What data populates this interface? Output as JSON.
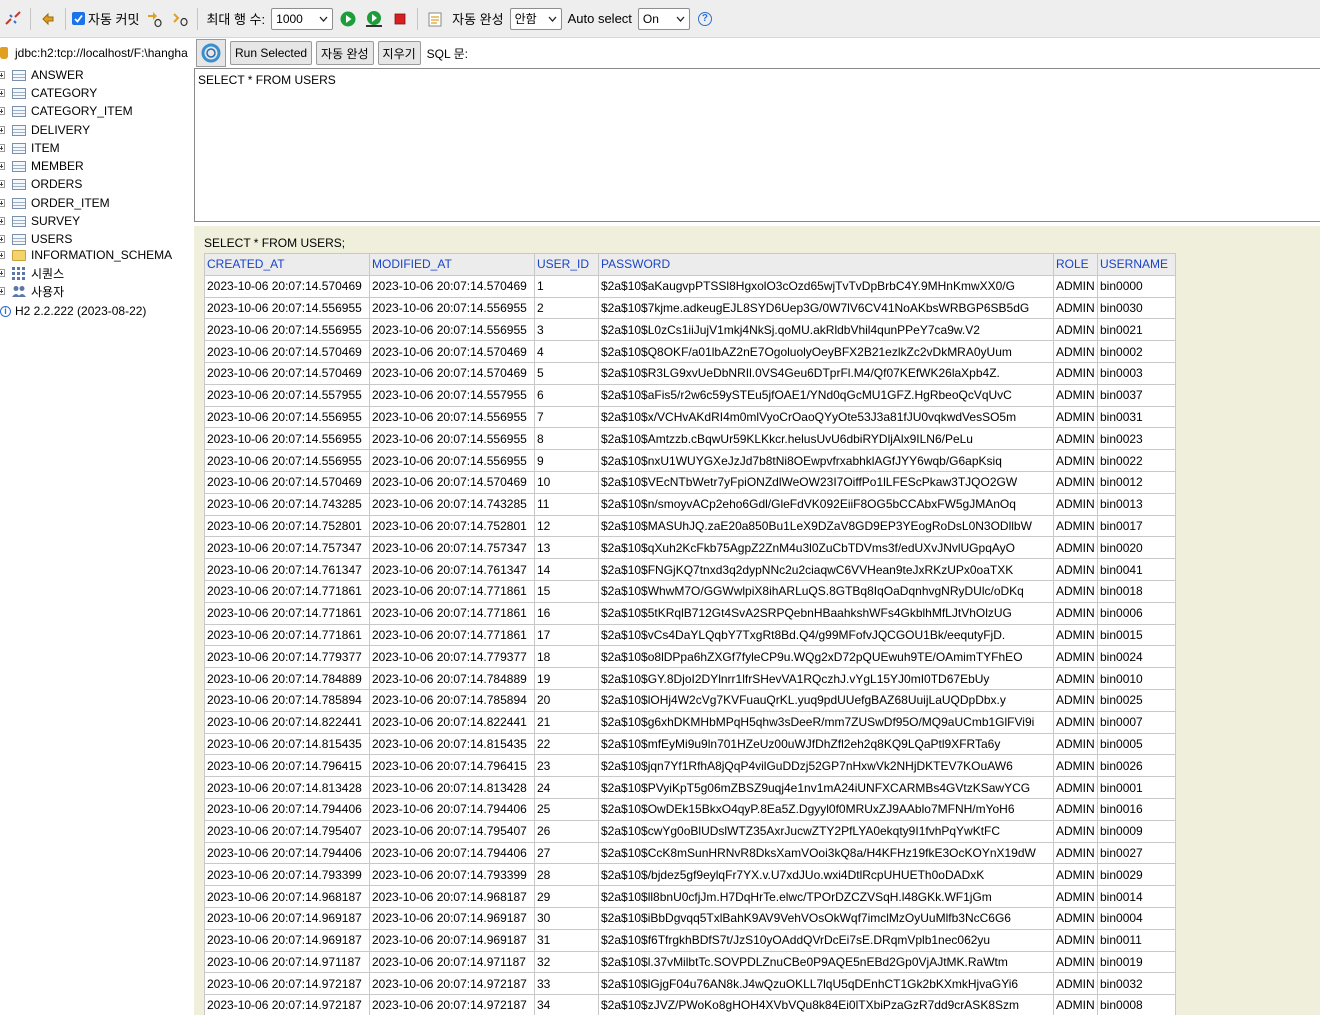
{
  "toolbar": {
    "auto_commit_label": "자동 커밋",
    "max_rows_label": "최대 행 수:",
    "max_rows_value": "1000",
    "autocomplete_label": "자동 완성",
    "autocomplete_value": "안함",
    "auto_select_label": "Auto select",
    "auto_select_value": "On",
    "help_glyph": "?"
  },
  "tree": {
    "connection": "jdbc:h2:tcp://localhost/F:\\hangha",
    "tables": [
      "ANSWER",
      "CATEGORY",
      "CATEGORY_ITEM",
      "DELIVERY",
      "ITEM",
      "MEMBER",
      "ORDERS",
      "ORDER_ITEM",
      "SURVEY",
      "USERS"
    ],
    "info_schema": "INFORMATION_SCHEMA",
    "sequences": "시퀀스",
    "users": "사용자",
    "version": "H2 2.2.222 (2023-08-22)"
  },
  "sqlbar": {
    "run_selected": "Run Selected",
    "auto_complete": "자동 완성",
    "clear": "지우기",
    "sql_label": "SQL 문:"
  },
  "editor": {
    "text": "SELECT * FROM USERS"
  },
  "result": {
    "query": "SELECT * FROM USERS;",
    "columns": [
      "CREATED_AT",
      "MODIFIED_AT",
      "USER_ID",
      "PASSWORD",
      "ROLE",
      "USERNAME"
    ],
    "rows": [
      [
        "2023-10-06 20:07:14.570469",
        "2023-10-06 20:07:14.570469",
        "1",
        "$2a$10$aKaugvpPTSSl8HgxolO3cOzd65wjTvTvDpBrbC4Y.9MHnKmwXX0/G",
        "ADMIN",
        "bin0000"
      ],
      [
        "2023-10-06 20:07:14.556955",
        "2023-10-06 20:07:14.556955",
        "2",
        "$2a$10$7kjme.adkeugEJL8SYD6Uep3G/0W7lV6CV41NoAKbsWRBGP6SB5dG",
        "ADMIN",
        "bin0030"
      ],
      [
        "2023-10-06 20:07:14.556955",
        "2023-10-06 20:07:14.556955",
        "3",
        "$2a$10$L0zCs1iiJujV1mkj4NkSj.qoMU.akRldbVhil4qunPPeY7ca9w.V2",
        "ADMIN",
        "bin0021"
      ],
      [
        "2023-10-06 20:07:14.570469",
        "2023-10-06 20:07:14.570469",
        "4",
        "$2a$10$Q8OKF/a01lbAZ2nE7OgoluolyOeyBFX2B21ezlkZc2vDkMRA0yUum",
        "ADMIN",
        "bin0002"
      ],
      [
        "2023-10-06 20:07:14.570469",
        "2023-10-06 20:07:14.570469",
        "5",
        "$2a$10$R3LG9xvUeDbNRIl.0VS4Geu6DTprFl.M4/Qf07KEfWK26laXpb4Z.",
        "ADMIN",
        "bin0003"
      ],
      [
        "2023-10-06 20:07:14.557955",
        "2023-10-06 20:07:14.557955",
        "6",
        "$2a$10$aFis5/r2w6c59ySTEu5jfOAE1/YNd0qGcMU1GFZ.HgRbeoQcVqUvC",
        "ADMIN",
        "bin0037"
      ],
      [
        "2023-10-06 20:07:14.556955",
        "2023-10-06 20:07:14.556955",
        "7",
        "$2a$10$x/VCHvAKdRI4m0mlVyoCrOaoQYyOte53J3a81fJU0vqkwdVesSO5m",
        "ADMIN",
        "bin0031"
      ],
      [
        "2023-10-06 20:07:14.556955",
        "2023-10-06 20:07:14.556955",
        "8",
        "$2a$10$Amtzzb.cBqwUr59KLKkcr.helusUvU6dbiRYDljAlx9ILN6/PeLu",
        "ADMIN",
        "bin0023"
      ],
      [
        "2023-10-06 20:07:14.556955",
        "2023-10-06 20:07:14.556955",
        "9",
        "$2a$10$nxU1WUYGXeJzJd7b8tNi8OEwpvfrxabhklAGfJYY6wqb/G6apKsiq",
        "ADMIN",
        "bin0022"
      ],
      [
        "2023-10-06 20:07:14.570469",
        "2023-10-06 20:07:14.570469",
        "10",
        "$2a$10$VEcNTbWetr7yFpiONZdlWeOW23I7OiffPo1lLFEScPkaw3TJQO2GW",
        "ADMIN",
        "bin0012"
      ],
      [
        "2023-10-06 20:07:14.743285",
        "2023-10-06 20:07:14.743285",
        "11",
        "$2a$10$n/smoyvACp2eho6Gdl/GleFdVK092EiiF8OG5bCCAbxFW5gJMAnOq",
        "ADMIN",
        "bin0013"
      ],
      [
        "2023-10-06 20:07:14.752801",
        "2023-10-06 20:07:14.752801",
        "12",
        "$2a$10$MASUhJQ.zaE20a850Bu1LeX9DZaV8GD9EP3YEogRoDsL0N3ODllbW",
        "ADMIN",
        "bin0017"
      ],
      [
        "2023-10-06 20:07:14.757347",
        "2023-10-06 20:07:14.757347",
        "13",
        "$2a$10$qXuh2KcFkb75AgpZ2ZnM4u3l0ZuCbTDVms3f/edUXvJNvlUGpqAyO",
        "ADMIN",
        "bin0020"
      ],
      [
        "2023-10-06 20:07:14.761347",
        "2023-10-06 20:07:14.761347",
        "14",
        "$2a$10$FNGjKQ7tnxd3q2dypNNc2u2ciaqwC6VVHean9teJxRKzUPx0oaTXK",
        "ADMIN",
        "bin0041"
      ],
      [
        "2023-10-06 20:07:14.771861",
        "2023-10-06 20:07:14.771861",
        "15",
        "$2a$10$WhwM7O/GGWwlpiX8ihARLuQS.8GTBq8IqOaDqnhvgNRyDUlc/oDKq",
        "ADMIN",
        "bin0018"
      ],
      [
        "2023-10-06 20:07:14.771861",
        "2023-10-06 20:07:14.771861",
        "16",
        "$2a$10$5tKRqlB712Gt4SvA2SRPQebnHBaahkshWFs4GkblhMfLJtVhOlzUG",
        "ADMIN",
        "bin0006"
      ],
      [
        "2023-10-06 20:07:14.771861",
        "2023-10-06 20:07:14.771861",
        "17",
        "$2a$10$vCs4DaYLQqbY7TxgRt8Bd.Q4/g99MFofvJQCGOU1Bk/eequtyFjD.",
        "ADMIN",
        "bin0015"
      ],
      [
        "2023-10-06 20:07:14.779377",
        "2023-10-06 20:07:14.779377",
        "18",
        "$2a$10$o8lDPpa6hZXGf7fyleCP9u.WQg2xD72pQUEwuh9TE/OAmimTYFhEO",
        "ADMIN",
        "bin0024"
      ],
      [
        "2023-10-06 20:07:14.784889",
        "2023-10-06 20:07:14.784889",
        "19",
        "$2a$10$GY.8DjoI2DYlnrr1lfrSHevVA1RQczhJ.vYgL15YJ0mI0TD67EbUy",
        "ADMIN",
        "bin0010"
      ],
      [
        "2023-10-06 20:07:14.785894",
        "2023-10-06 20:07:14.785894",
        "20",
        "$2a$10$lOHj4W2cVg7KVFuauQrKL.yuq9pdUUefgBAZ68UuijLaUQDpDbx.y",
        "ADMIN",
        "bin0025"
      ],
      [
        "2023-10-06 20:07:14.822441",
        "2023-10-06 20:07:14.822441",
        "21",
        "$2a$10$g6xhDKMHbMPqH5qhw3sDeeR/mm7ZUSwDf95O/MQ9aUCmb1GlFVi9i",
        "ADMIN",
        "bin0007"
      ],
      [
        "2023-10-06 20:07:14.815435",
        "2023-10-06 20:07:14.815435",
        "22",
        "$2a$10$mfEyMi9u9ln701HZeUz00uWJfDhZfl2eh2q8KQ9LQaPtl9XFRTa6y",
        "ADMIN",
        "bin0005"
      ],
      [
        "2023-10-06 20:07:14.796415",
        "2023-10-06 20:07:14.796415",
        "23",
        "$2a$10$jqn7Yf1RfhA8jQqP4vilGuDDzj52GP7nHxwVk2NHjDKTEV7KOuAW6",
        "ADMIN",
        "bin0026"
      ],
      [
        "2023-10-06 20:07:14.813428",
        "2023-10-06 20:07:14.813428",
        "24",
        "$2a$10$PVyiKpT5g06mZBSZ9uqj4e1nv1mA24iUNFXCARMBs4GVtzKSawYCG",
        "ADMIN",
        "bin0001"
      ],
      [
        "2023-10-06 20:07:14.794406",
        "2023-10-06 20:07:14.794406",
        "25",
        "$2a$10$OwDEk15BkxO4qyP.8Ea5Z.Dgyyl0f0MRUxZJ9AAblo7MFNH/mYoH6",
        "ADMIN",
        "bin0016"
      ],
      [
        "2023-10-06 20:07:14.795407",
        "2023-10-06 20:07:14.795407",
        "26",
        "$2a$10$cwYg0oBlUDslWTZ35AxrJucwZTY2PfLYA0ekqty9I1fvhPqYwKtFC",
        "ADMIN",
        "bin0009"
      ],
      [
        "2023-10-06 20:07:14.794406",
        "2023-10-06 20:07:14.794406",
        "27",
        "$2a$10$CcK8mSunHRNvR8DksXamVOoi3kQ8a/H4KFHz19fkE3OcKOYnX19dW",
        "ADMIN",
        "bin0027"
      ],
      [
        "2023-10-06 20:07:14.793399",
        "2023-10-06 20:07:14.793399",
        "28",
        "$2a$10$/bjdez5gf9eylqFr7YX.v.U7xdJUo.wxi4DtlRcpUHUETh0oDADxK",
        "ADMIN",
        "bin0029"
      ],
      [
        "2023-10-06 20:07:14.968187",
        "2023-10-06 20:07:14.968187",
        "29",
        "$2a$10$ll8bnU0cfjJm.H7DqHrTe.elwc/TPOrDZCZVSqH.l48GKk.WF1jGm",
        "ADMIN",
        "bin0014"
      ],
      [
        "2023-10-06 20:07:14.969187",
        "2023-10-06 20:07:14.969187",
        "30",
        "$2a$10$iBbDgvqq5TxlBahK9AV9VehVOsOkWqf7imclMzOyUuMlfb3NcC6G6",
        "ADMIN",
        "bin0004"
      ],
      [
        "2023-10-06 20:07:14.969187",
        "2023-10-06 20:07:14.969187",
        "31",
        "$2a$10$f6TfrgkhBDfS7t/JzS10yOAddQVrDcEi7sE.DRqmVplb1nec062yu",
        "ADMIN",
        "bin0011"
      ],
      [
        "2023-10-06 20:07:14.971187",
        "2023-10-06 20:07:14.971187",
        "32",
        "$2a$10$l.37vMilbtTc.SOVPDLZnuCBe0P9AQE5nEBd2Gp0VjAJtMK.RaWtm",
        "ADMIN",
        "bin0019"
      ],
      [
        "2023-10-06 20:07:14.972187",
        "2023-10-06 20:07:14.972187",
        "33",
        "$2a$10$lGjgF04u76AN8k.J4wQzuOKLL7lqU5qDEnhCT1Gk2bKXmkHjvaGYi6",
        "ADMIN",
        "bin0032"
      ],
      [
        "2023-10-06 20:07:14.972187",
        "2023-10-06 20:07:14.972187",
        "34",
        "$2a$10$zJVZ/PWoKo8gHOH4XVbVQu8k84Ei0lTXbiPzaGzR7dd9crASK8Szm",
        "ADMIN",
        "bin0008"
      ]
    ]
  },
  "colors": {
    "result_bg": "#efefdc",
    "header_link": "#1a44c8",
    "run_green": "#1e9e3a",
    "stop_red": "#d42020"
  }
}
